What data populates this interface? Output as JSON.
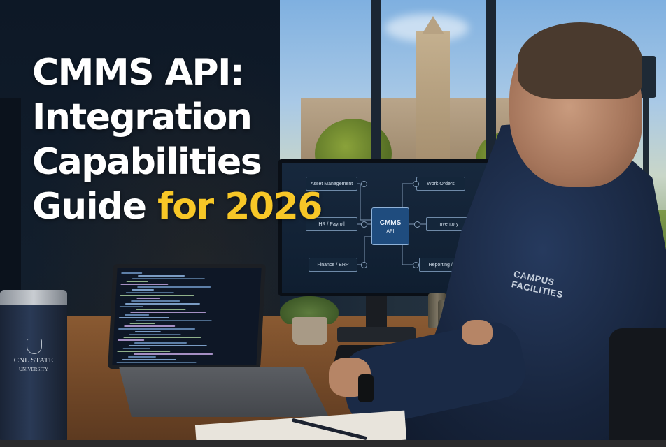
{
  "headline": {
    "line1": "CMMS API:",
    "line2": "Integration",
    "line3": "Capabilities",
    "line4_prefix": "Guide",
    "line4_accent": "for 2026"
  },
  "diagram": {
    "hub_title": "CMMS",
    "hub_subtitle": "API",
    "nodes": {
      "asset_management": "Asset Management",
      "work_orders": "Work Orders",
      "hr_payroll": "HR / Payroll",
      "inventory": "Inventory",
      "finance_erp": "Finance / ERP",
      "reporting_bi": "Reporting / BI"
    }
  },
  "sleeve_print": {
    "line1": "CAMPUS",
    "line2": "FACILITIES"
  },
  "tumbler_print": {
    "line1": "CNL STATE",
    "line2": "UNIVERSITY"
  },
  "colors": {
    "accent_yellow": "#f7c727",
    "headline_white": "#ffffff",
    "hub_blue": "#1f4c7e",
    "jacket_navy": "#17243c"
  }
}
